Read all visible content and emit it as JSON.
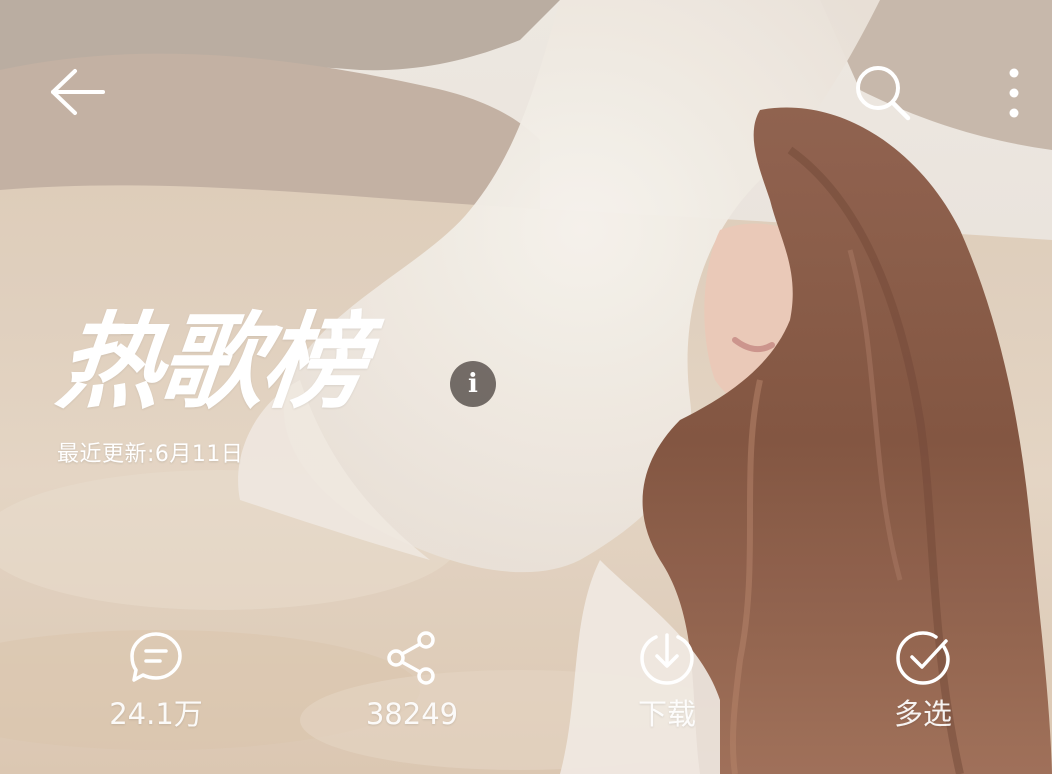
{
  "header": {
    "back_icon": "arrow-left-icon",
    "search_icon": "search-icon",
    "more_icon": "more-vertical-icon"
  },
  "playlist": {
    "title": "热歌榜",
    "info_glyph": "i",
    "updated": "最近更新:6月11日"
  },
  "actions": [
    {
      "icon": "comment-icon",
      "label": "24.1万"
    },
    {
      "icon": "share-icon",
      "label": "38249"
    },
    {
      "icon": "download-icon",
      "label": "下载"
    },
    {
      "icon": "multiselect-check-icon",
      "label": "多选"
    }
  ],
  "colors": {
    "foreground": "#ffffff",
    "info_badge": "#504844"
  }
}
